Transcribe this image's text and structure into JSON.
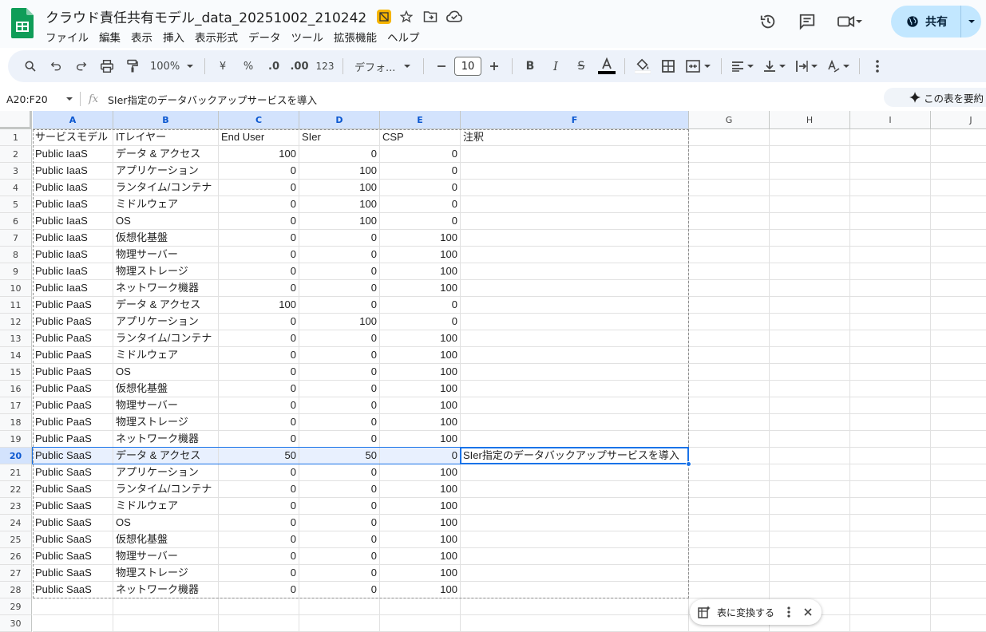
{
  "doc": {
    "title": "クラウド責任共有モデル_data_20251002_210242",
    "menu": [
      "ファイル",
      "編集",
      "表示",
      "挿入",
      "表示形式",
      "データ",
      "ツール",
      "拡張機能",
      "ヘルプ"
    ],
    "share_label": "共有"
  },
  "toolbar": {
    "zoom": "100%",
    "currency": "¥",
    "percent": "%",
    "dec_decrease": ".0",
    "dec_increase": ".00",
    "number_format": "123",
    "font": "デフォ...",
    "font_size": "10"
  },
  "formula_bar": {
    "name_box": "A20:F20",
    "fx": "fx",
    "content": "SIer指定のデータバックアップサービスを導入",
    "summarize_label": "この表を要約"
  },
  "columns": [
    "A",
    "B",
    "C",
    "D",
    "E",
    "F",
    "G",
    "H",
    "I",
    "J"
  ],
  "rows": [
    [
      "サービスモデル",
      "ITレイヤー",
      "End User",
      "SIer",
      "CSP",
      "注釈"
    ],
    [
      "Public IaaS",
      "データ & アクセス",
      "100",
      "0",
      "0",
      ""
    ],
    [
      "Public IaaS",
      "アプリケーション",
      "0",
      "100",
      "0",
      ""
    ],
    [
      "Public IaaS",
      "ランタイム/コンテナ",
      "0",
      "100",
      "0",
      ""
    ],
    [
      "Public IaaS",
      "ミドルウェア",
      "0",
      "100",
      "0",
      ""
    ],
    [
      "Public IaaS",
      "OS",
      "0",
      "100",
      "0",
      ""
    ],
    [
      "Public IaaS",
      "仮想化基盤",
      "0",
      "0",
      "100",
      ""
    ],
    [
      "Public IaaS",
      "物理サーバー",
      "0",
      "0",
      "100",
      ""
    ],
    [
      "Public IaaS",
      "物理ストレージ",
      "0",
      "0",
      "100",
      ""
    ],
    [
      "Public IaaS",
      "ネットワーク機器",
      "0",
      "0",
      "100",
      ""
    ],
    [
      "Public PaaS",
      "データ & アクセス",
      "100",
      "0",
      "0",
      ""
    ],
    [
      "Public PaaS",
      "アプリケーション",
      "0",
      "100",
      "0",
      ""
    ],
    [
      "Public PaaS",
      "ランタイム/コンテナ",
      "0",
      "0",
      "100",
      ""
    ],
    [
      "Public PaaS",
      "ミドルウェア",
      "0",
      "0",
      "100",
      ""
    ],
    [
      "Public PaaS",
      "OS",
      "0",
      "0",
      "100",
      ""
    ],
    [
      "Public PaaS",
      "仮想化基盤",
      "0",
      "0",
      "100",
      ""
    ],
    [
      "Public PaaS",
      "物理サーバー",
      "0",
      "0",
      "100",
      ""
    ],
    [
      "Public PaaS",
      "物理ストレージ",
      "0",
      "0",
      "100",
      ""
    ],
    [
      "Public PaaS",
      "ネットワーク機器",
      "0",
      "0",
      "100",
      ""
    ],
    [
      "Public SaaS",
      "データ & アクセス",
      "50",
      "50",
      "0",
      "SIer指定のデータバックアップサービスを導入"
    ],
    [
      "Public SaaS",
      "アプリケーション",
      "0",
      "0",
      "100",
      ""
    ],
    [
      "Public SaaS",
      "ランタイム/コンテナ",
      "0",
      "0",
      "100",
      ""
    ],
    [
      "Public SaaS",
      "ミドルウェア",
      "0",
      "0",
      "100",
      ""
    ],
    [
      "Public SaaS",
      "OS",
      "0",
      "0",
      "100",
      ""
    ],
    [
      "Public SaaS",
      "仮想化基盤",
      "0",
      "0",
      "100",
      ""
    ],
    [
      "Public SaaS",
      "物理サーバー",
      "0",
      "0",
      "100",
      ""
    ],
    [
      "Public SaaS",
      "物理ストレージ",
      "0",
      "0",
      "100",
      ""
    ],
    [
      "Public SaaS",
      "ネットワーク機器",
      "0",
      "0",
      "100",
      ""
    ],
    [
      "",
      "",
      "",
      "",
      "",
      ""
    ],
    [
      "",
      "",
      "",
      "",
      "",
      ""
    ]
  ],
  "selected_row": 20,
  "selected_cols": [
    "A",
    "B",
    "C",
    "D",
    "E",
    "F"
  ],
  "convert_chip": {
    "label": "表に変換する"
  },
  "colors": {
    "accent": "#1a73e8",
    "header_sel": "#d3e3fd",
    "share_bg": "#c2e7ff"
  }
}
